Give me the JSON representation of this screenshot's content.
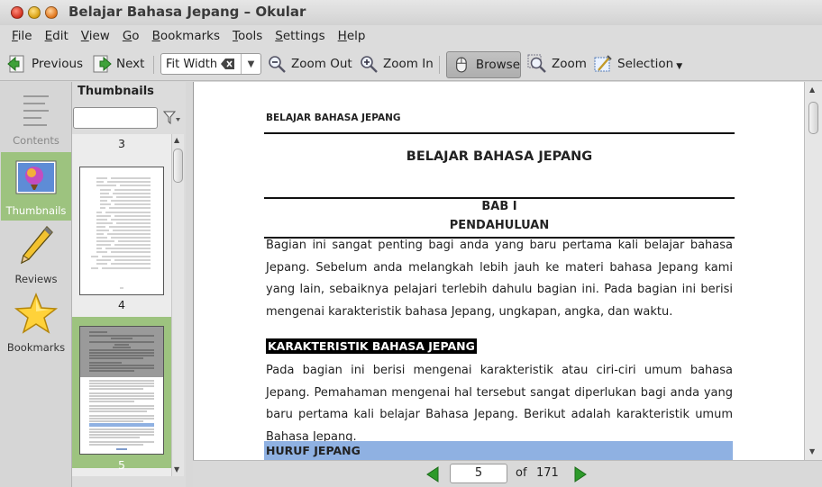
{
  "window": {
    "title": "Belajar Bahasa Jepang – Okular"
  },
  "menu": [
    {
      "label": "File",
      "u": "F",
      "rest": "ile"
    },
    {
      "label": "Edit",
      "u": "E",
      "rest": "dit"
    },
    {
      "label": "View",
      "u": "V",
      "rest": "iew"
    },
    {
      "label": "Go",
      "u": "G",
      "rest": "o"
    },
    {
      "label": "Bookmarks",
      "u": "B",
      "rest": "ookmarks"
    },
    {
      "label": "Tools",
      "u": "T",
      "rest": "ools"
    },
    {
      "label": "Settings",
      "u": "S",
      "rest": "ettings"
    },
    {
      "label": "Help",
      "u": "H",
      "rest": "elp"
    }
  ],
  "toolbar": {
    "previous": "Previous",
    "next": "Next",
    "zoom_mode": "Fit Width",
    "zoom_out": "Zoom Out",
    "zoom_in": "Zoom In",
    "browse": "Browse",
    "zoom": "Zoom",
    "selection": "Selection"
  },
  "sidebar": {
    "items": [
      {
        "label": "Contents",
        "icon": "contents-icon",
        "state": "disabled"
      },
      {
        "label": "Thumbnails",
        "icon": "thumbnails-icon",
        "state": "active"
      },
      {
        "label": "Reviews",
        "icon": "pencil-icon",
        "state": "normal"
      },
      {
        "label": "Bookmarks",
        "icon": "star-icon",
        "state": "normal"
      }
    ]
  },
  "thumbnails": {
    "heading": "Thumbnails",
    "search_value": "",
    "pages": [
      {
        "number": "3"
      },
      {
        "number": "4"
      },
      {
        "number": "5",
        "selected": true
      }
    ]
  },
  "document": {
    "running_header": "BELAJAR BAHASA JEPANG",
    "title": "BELAJAR BAHASA JEPANG",
    "chapter": "BAB I",
    "chapter_title": "PENDAHULUAN",
    "para1": "Bagian ini sangat penting bagi anda yang baru pertama kali belajar bahasa Jepang. Sebelum anda melangkah lebih jauh ke materi bahasa Jepang kami yang lain, sebaiknya pelajari terlebih dahulu bagian ini. Pada bagian ini berisi mengenai karakteristik bahasa Jepang, ungkapan, angka, dan waktu.",
    "section1": "KARAKTERISTIK BAHASA JEPANG",
    "para2": "Pada bagian ini berisi mengenai karakteristik atau ciri-ciri umum bahasa Jepang. Pemahaman mengenai hal tersebut sangat diperlukan bagi anda yang baru pertama kali belajar Bahasa Jepang. Berikut adalah karakteristik umum Bahasa Jepang.",
    "section2": "HURUF JEPANG"
  },
  "navigation": {
    "current_page": "5",
    "of_label": "of",
    "total_pages": "171"
  },
  "colors": {
    "selection_green": "#9dc37f",
    "heading_blue": "#8fb1e2",
    "nav_green": "#2d9a2a"
  }
}
